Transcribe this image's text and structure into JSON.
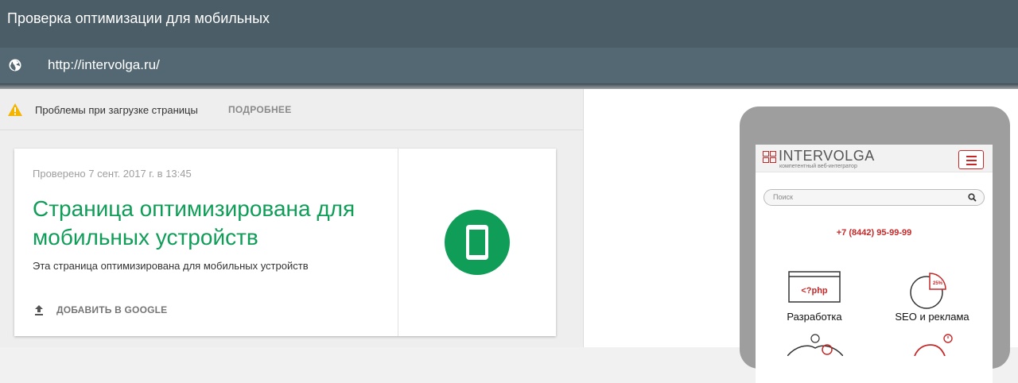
{
  "header": {
    "title": "Проверка оптимизации для мобильных"
  },
  "urlbar": {
    "url": "http://intervolga.ru/",
    "icon": "globe-icon"
  },
  "warning": {
    "icon": "warning-icon",
    "message": "Проблемы при загрузке страницы",
    "details_label": "ПОДРОБНЕЕ"
  },
  "result": {
    "checked_at": "Проверено 7 сент. 2017 г. в 13:45",
    "headline": "Страница оптимизирована для мобильных устройств",
    "description": "Эта страница оптимизирована для мобильных устройств",
    "add_label": "ДОБАВИТЬ В GOOGLE",
    "status_color": "#0f9d58"
  },
  "preview": {
    "logo": "INTERVOLGA",
    "tagline": "компетентный веб-интегратор",
    "search_placeholder": "Поиск",
    "phone": "+7 (8442) 95-99-99",
    "services": [
      {
        "label": "Разработка",
        "icon_text": "<?php"
      },
      {
        "label": "SEO и реклама",
        "icon_text": "25%"
      }
    ],
    "accent_color": "#c62828"
  }
}
